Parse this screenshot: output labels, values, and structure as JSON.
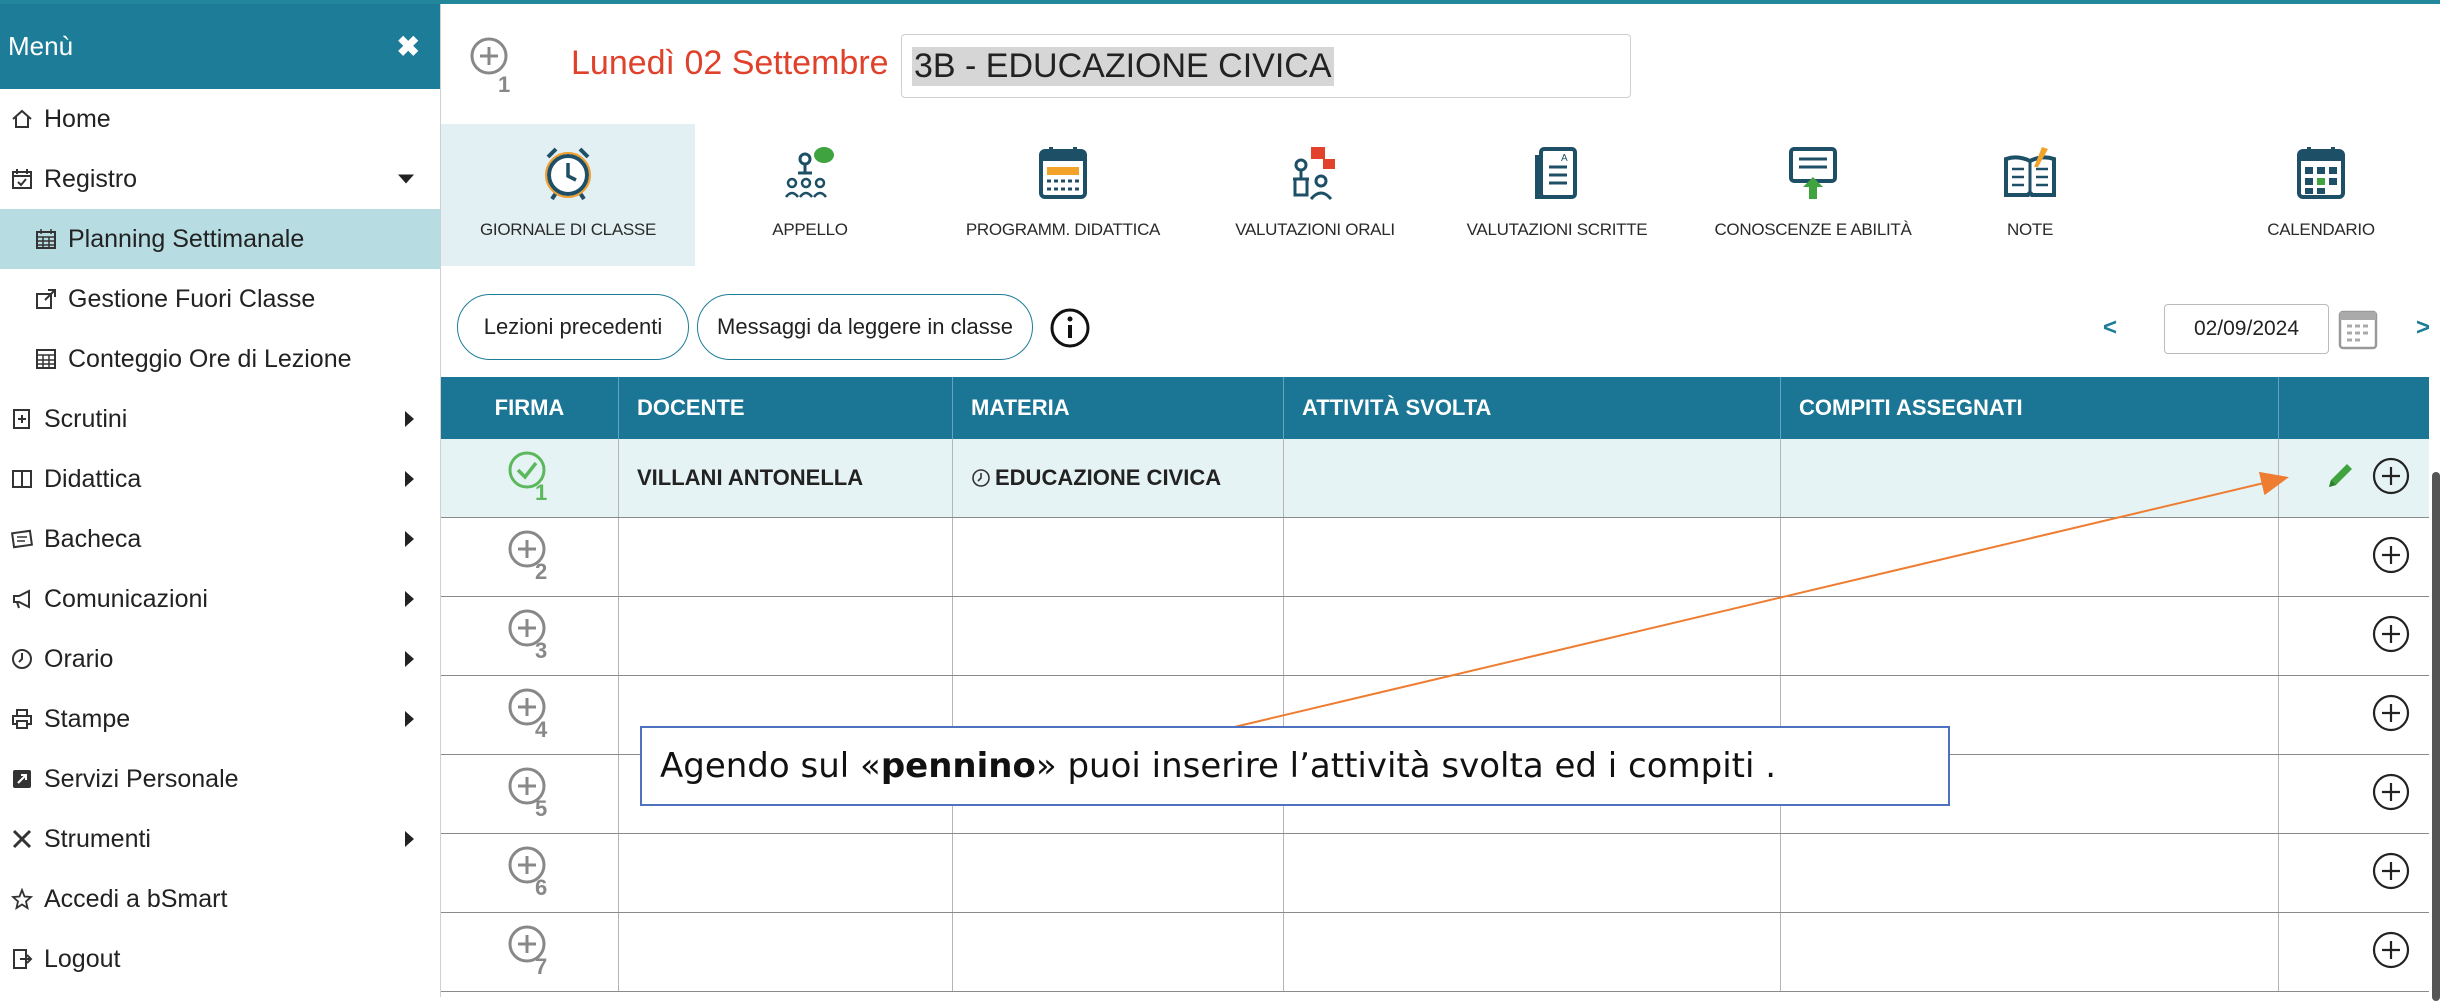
{
  "sidebar": {
    "title": "Menù",
    "items": [
      {
        "label": "Home",
        "icon": "home-icon",
        "caret": ""
      },
      {
        "label": "Registro",
        "icon": "calendar-check-icon",
        "caret": "down"
      },
      {
        "label": "Planning Settimanale",
        "icon": "calendar-icon",
        "caret": "",
        "sub": true,
        "active": true
      },
      {
        "label": "Gestione Fuori Classe",
        "icon": "external-link-icon",
        "caret": "",
        "sub": true
      },
      {
        "label": "Conteggio Ore di Lezione",
        "icon": "table-icon",
        "caret": "",
        "sub": true
      },
      {
        "label": "Scrutini",
        "icon": "report-icon",
        "caret": "right"
      },
      {
        "label": "Didattica",
        "icon": "book-icon",
        "caret": "right"
      },
      {
        "label": "Bacheca",
        "icon": "board-icon",
        "caret": "right"
      },
      {
        "label": "Comunicazioni",
        "icon": "megaphone-icon",
        "caret": "right"
      },
      {
        "label": "Orario",
        "icon": "clock-icon",
        "caret": "right"
      },
      {
        "label": "Stampe",
        "icon": "printer-icon",
        "caret": "right"
      },
      {
        "label": "Servizi Personale",
        "icon": "share-icon",
        "caret": ""
      },
      {
        "label": "Strumenti",
        "icon": "tools-icon",
        "caret": "right"
      },
      {
        "label": "Accedi a bSmart",
        "icon": "star-icon",
        "caret": ""
      },
      {
        "label": "Logout",
        "icon": "logout-icon",
        "caret": ""
      }
    ]
  },
  "header": {
    "date_title": "Lunedì 02 Settembre",
    "class_subject": "3B - EDUCAZIONE CIVICA",
    "plus_number": "1"
  },
  "toolbar": [
    {
      "label": "GIORNALE DI CLASSE",
      "icon": "alarm-clock-icon"
    },
    {
      "label": "APPELLO",
      "icon": "attendance-icon"
    },
    {
      "label": "PROGRAMM. DIDATTICA",
      "icon": "planning-calendar-icon"
    },
    {
      "label": "VALUTAZIONI ORALI",
      "icon": "oral-grades-icon"
    },
    {
      "label": "VALUTAZIONI SCRITTE",
      "icon": "written-grades-icon"
    },
    {
      "label": "CONOSCENZE E ABILITÀ",
      "icon": "skills-icon"
    },
    {
      "label": "NOTE",
      "icon": "notes-icon"
    },
    {
      "label": "CALENDARIO",
      "icon": "calendar-grid-icon"
    }
  ],
  "actions": {
    "prev_lessons": "Lezioni precedenti",
    "messages": "Messaggi da leggere in classe",
    "prev": "<",
    "next": ">",
    "date_value": "02/09/2024"
  },
  "table": {
    "headers": [
      "FIRMA",
      "DOCENTE",
      "MATERIA",
      "ATTIVITÀ SVOLTA",
      "COMPITI ASSEGNATI",
      ""
    ],
    "rows": [
      {
        "hour": "1",
        "signed": true,
        "docente": "VILLANI ANTONELLA",
        "materia": "EDUCAZIONE CIVICA"
      },
      {
        "hour": "2",
        "signed": false,
        "docente": "",
        "materia": ""
      },
      {
        "hour": "3",
        "signed": false,
        "docente": "",
        "materia": ""
      },
      {
        "hour": "4",
        "signed": false,
        "docente": "",
        "materia": ""
      },
      {
        "hour": "5",
        "signed": false,
        "docente": "",
        "materia": ""
      },
      {
        "hour": "6",
        "signed": false,
        "docente": "",
        "materia": ""
      },
      {
        "hour": "7",
        "signed": false,
        "docente": "",
        "materia": ""
      }
    ]
  },
  "callout": {
    "before": "Agendo sul «",
    "bold": "pennino",
    "after": "» puoi inserire l’attività svolta ed i compiti ."
  },
  "colors": {
    "accent": "#1d7d98",
    "date_red": "#e0412b",
    "signed_green": "#5cb85c",
    "arrow_orange": "#ee7d31"
  }
}
